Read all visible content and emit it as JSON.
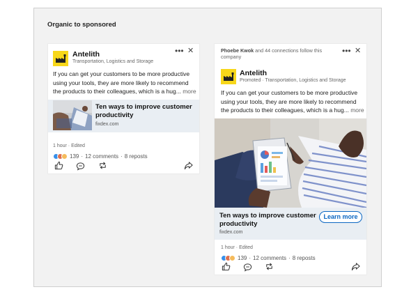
{
  "panel": {
    "title": "Organic to sponsored"
  },
  "organic": {
    "company": "Antelith",
    "subtitle": "Transportation, Logistics and Storage",
    "text": "If you can get your customers to be more productive using your tools, they are more likely to recommend the products to their colleagues, which is a hug...",
    "more": "more",
    "link_title": "Ten ways to improve customer productivity",
    "link_domain": "fixdex.com",
    "meta": "1 hour · Edited",
    "reactions_count": "139",
    "comments": "12 comments",
    "reposts": "8 reposts",
    "separator": "·"
  },
  "sponsored": {
    "social_name": "Phoebe Kwok",
    "social_text": " and 44 connections follow this company",
    "company": "Antelith",
    "subtitle": "Promoted · Transportation, Logistics and Storage",
    "text": "If you can get your customers to be more productive using your tools, they are more likely to recommend the products to their colleagues, which is a hug...",
    "more": "more",
    "link_title": "Ten ways to improve customer productivity",
    "link_domain": "fixdex.com",
    "cta": "Learn more",
    "meta": "1 hour · Edited",
    "reactions_count": "139",
    "comments": "12 comments",
    "reposts": "8 reposts",
    "separator": "·"
  },
  "icons": {
    "more": "three-dots-icon",
    "close": "close-icon",
    "like": "thumbs-up-icon",
    "comment": "comment-icon",
    "repost": "repost-icon",
    "share": "share-icon"
  },
  "colors": {
    "brand_blue": "#0a66c2",
    "logo_yellow": "#f7d71a",
    "panel_bg": "#f2f2f2"
  }
}
